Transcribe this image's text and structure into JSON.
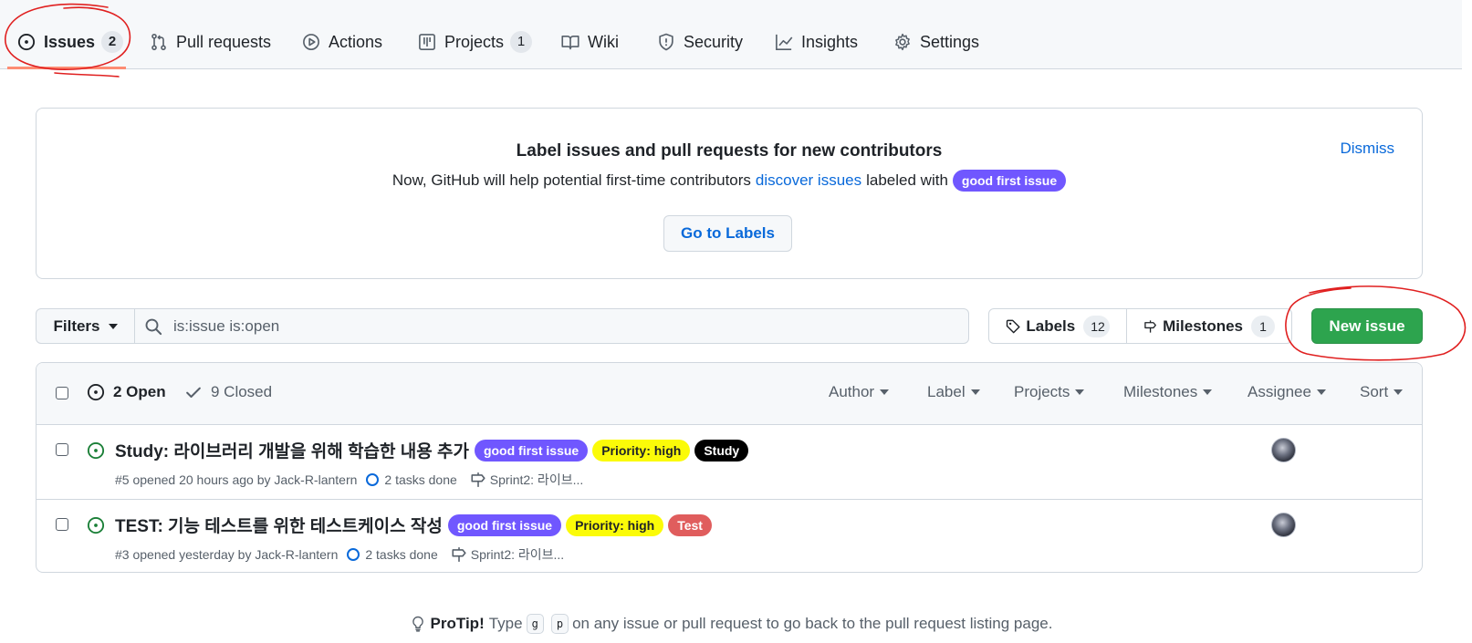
{
  "nav": {
    "tabs": [
      {
        "label": "Issues",
        "count": "2",
        "icon": "issue-opened-icon"
      },
      {
        "label": "Pull requests",
        "icon": "git-pull-request-icon"
      },
      {
        "label": "Actions",
        "icon": "play-icon"
      },
      {
        "label": "Projects",
        "count": "1",
        "icon": "table-icon"
      },
      {
        "label": "Wiki",
        "icon": "book-icon"
      },
      {
        "label": "Security",
        "icon": "shield-icon"
      },
      {
        "label": "Insights",
        "icon": "graph-icon"
      },
      {
        "label": "Settings",
        "icon": "gear-icon"
      }
    ],
    "selected": "Issues"
  },
  "banner": {
    "title": "Label issues and pull requests for new contributors",
    "text_before": "Now, GitHub will help potential first-time contributors",
    "link": "discover issues",
    "text_after": "labeled with",
    "label": "good first issue",
    "button": "Go to Labels",
    "dismiss": "Dismiss"
  },
  "toolbar": {
    "filters": "Filters",
    "search_value": "is:issue is:open",
    "labels": "Labels",
    "labels_count": "12",
    "milestones": "Milestones",
    "milestones_count": "1",
    "new_issue": "New issue"
  },
  "list_header": {
    "open": "2 Open",
    "closed": "9 Closed",
    "filters": [
      "Author",
      "Label",
      "Projects",
      "Milestones",
      "Assignee",
      "Sort"
    ]
  },
  "issues": [
    {
      "title": "Study: 라이브러리 개발을 위해 학습한 내용 추가",
      "labels": [
        {
          "name": "good first issue",
          "color": "#7057ff",
          "text_color": "#ffffff"
        },
        {
          "name": "Priority: high",
          "color": "#fbfb08",
          "text_color": "#1f2328"
        },
        {
          "name": "Study",
          "color": "#000000",
          "text_color": "#ffffff"
        }
      ],
      "meta": "#5 opened 20 hours ago by Jack-R-lantern",
      "tasks": "2 tasks done",
      "milestone": "Sprint2: 라이브..."
    },
    {
      "title": "TEST: 기능 테스트를 위한 테스트케이스 작성",
      "labels": [
        {
          "name": "good first issue",
          "color": "#7057ff",
          "text_color": "#ffffff"
        },
        {
          "name": "Priority: high",
          "color": "#fbfb08",
          "text_color": "#1f2328"
        },
        {
          "name": "Test",
          "color": "#e05d5d",
          "text_color": "#ffffff"
        }
      ],
      "meta": "#3 opened yesterday by Jack-R-lantern",
      "tasks": "2 tasks done",
      "milestone": "Sprint2: 라이브..."
    }
  ],
  "protip": {
    "title": "ProTip!",
    "before": "Type",
    "key1": "g",
    "key2": "p",
    "after": "on any issue or pull request to go back to the pull request listing page."
  },
  "colors": {
    "accent_link": "#0969da",
    "primary_button": "#2da44e",
    "open_icon": "#1a7f37",
    "annotation": "#e02020"
  }
}
